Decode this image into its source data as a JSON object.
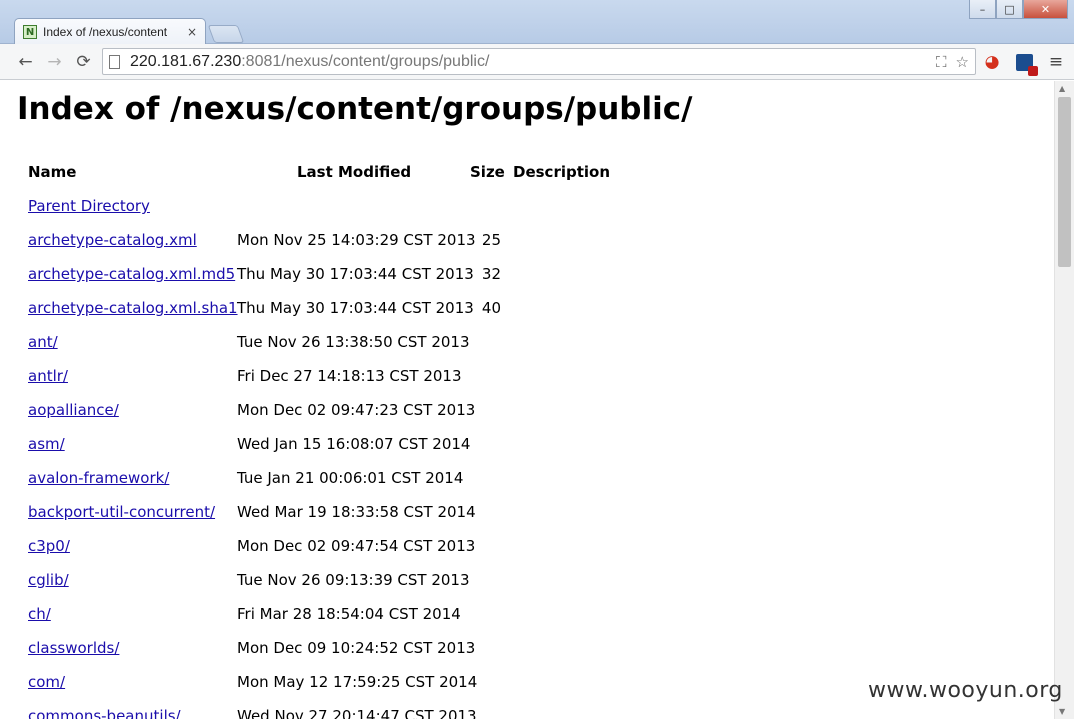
{
  "tab": {
    "title": "Index of /nexus/content",
    "close": "×",
    "favicon": "N"
  },
  "window": {
    "minimize": "–",
    "maximize": "□",
    "close": "✕"
  },
  "nav": {
    "back": "←",
    "forward": "→",
    "reload": "⟳"
  },
  "address": {
    "host": "220.181.67.230",
    "rest": ":8081/nexus/content/groups/public/"
  },
  "omnibox_icons": {
    "translate": "⛶",
    "star": "☆"
  },
  "menu_icon": "≡",
  "page": {
    "heading": "Index of /nexus/content/groups/public/"
  },
  "table": {
    "headers": {
      "name": "Name",
      "modified": "Last Modified",
      "size": "Size",
      "description": "Description"
    },
    "rows": [
      {
        "name": "Parent Directory",
        "modified": "",
        "size": ""
      },
      {
        "name": "archetype-catalog.xml",
        "modified": "Mon Nov 25 14:03:29 CST 2013",
        "size": "25"
      },
      {
        "name": "archetype-catalog.xml.md5",
        "modified": "Thu May 30 17:03:44 CST 2013",
        "size": "32"
      },
      {
        "name": "archetype-catalog.xml.sha1",
        "modified": "Thu May 30 17:03:44 CST 2013",
        "size": "40"
      },
      {
        "name": "ant/",
        "modified": "Tue Nov 26 13:38:50 CST 2013",
        "size": ""
      },
      {
        "name": "antlr/",
        "modified": "Fri Dec 27 14:18:13 CST 2013",
        "size": ""
      },
      {
        "name": "aopalliance/",
        "modified": "Mon Dec 02 09:47:23 CST 2013",
        "size": ""
      },
      {
        "name": "asm/",
        "modified": "Wed Jan 15 16:08:07 CST 2014",
        "size": ""
      },
      {
        "name": "avalon-framework/",
        "modified": "Tue Jan 21 00:06:01 CST 2014",
        "size": ""
      },
      {
        "name": "backport-util-concurrent/",
        "modified": "Wed Mar 19 18:33:58 CST 2014",
        "size": ""
      },
      {
        "name": "c3p0/",
        "modified": "Mon Dec 02 09:47:54 CST 2013",
        "size": ""
      },
      {
        "name": "cglib/",
        "modified": "Tue Nov 26 09:13:39 CST 2013",
        "size": ""
      },
      {
        "name": "ch/",
        "modified": "Fri Mar 28 18:54:04 CST 2014",
        "size": ""
      },
      {
        "name": "classworlds/",
        "modified": "Mon Dec 09 10:24:52 CST 2013",
        "size": ""
      },
      {
        "name": "com/",
        "modified": "Mon May 12 17:59:25 CST 2014",
        "size": ""
      },
      {
        "name": "commons-beanutils/",
        "modified": "Wed Nov 27 20:14:47 CST 2013",
        "size": ""
      }
    ]
  },
  "watermark": "www.wooyun.org"
}
